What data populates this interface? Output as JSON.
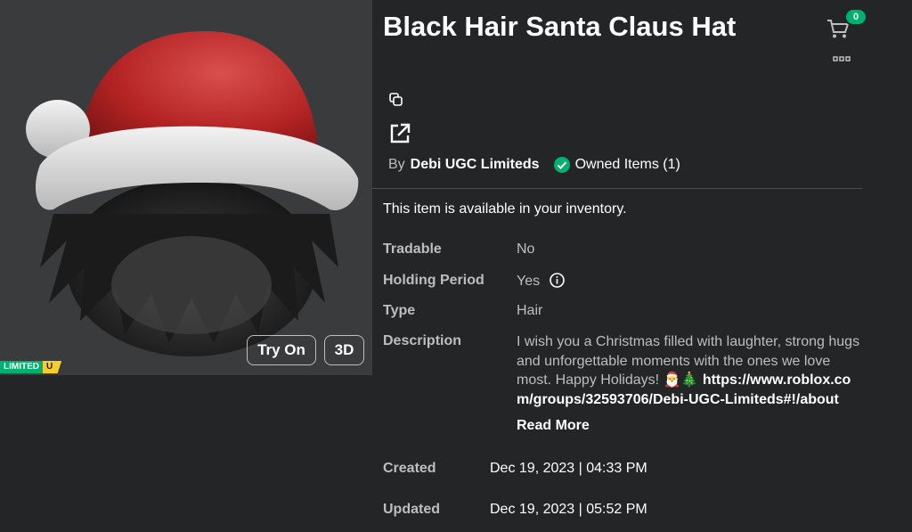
{
  "item": {
    "title": "Black Hair Santa Claus Hat",
    "limited_label": "LIMITED",
    "limited_unique": "U",
    "try_on_label": "Try On",
    "view_3d_label": "3D"
  },
  "header": {
    "cart_count": "0"
  },
  "byline": {
    "by": "By",
    "creator": "Debi UGC Limiteds",
    "owned": "Owned Items (1)"
  },
  "availability": "This item is available in your inventory.",
  "details": {
    "tradable": {
      "label": "Tradable",
      "value": "No"
    },
    "holding_period": {
      "label": "Holding Period",
      "value": "Yes"
    },
    "type": {
      "label": "Type",
      "value": "Hair"
    },
    "description": {
      "label": "Description",
      "text": "I wish you a Christmas filled with laughter, strong hugs and unforgettable moments with the ones we love most. Happy Holidays! 🎅🎄",
      "link": "https://www.roblox.com/groups/32593706/Debi-UGC-Limiteds#!/about",
      "read_more": "Read More"
    },
    "created": {
      "label": "Created",
      "value": "Dec 19, 2023 | 04:33 PM"
    },
    "updated": {
      "label": "Updated",
      "value": "Dec 19, 2023 | 05:52 PM"
    }
  },
  "colors": {
    "background": "#232527",
    "panel": "#393b3d",
    "accent_green": "#00b06f",
    "muted_text": "#bdbebe"
  },
  "icons": [
    "copy-icon",
    "share-icon",
    "cart-icon",
    "more-options-icon",
    "check-circle-icon",
    "info-icon"
  ]
}
